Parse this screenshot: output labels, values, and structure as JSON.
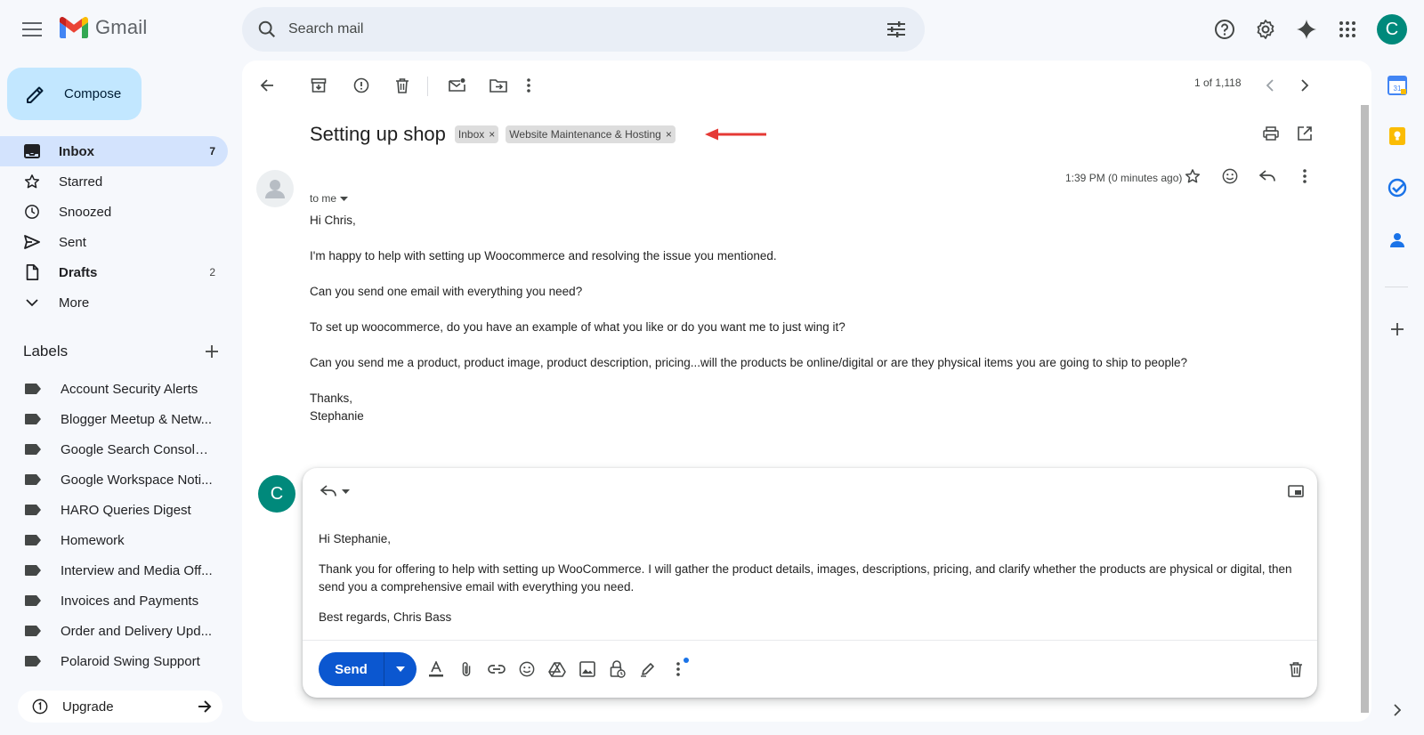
{
  "app": {
    "name": "Gmail"
  },
  "search": {
    "placeholder": "Search mail"
  },
  "sidebar": {
    "compose_label": "Compose",
    "items": [
      {
        "label": "Inbox",
        "count": "7",
        "icon": "inbox-icon"
      },
      {
        "label": "Starred",
        "count": "",
        "icon": "star-icon"
      },
      {
        "label": "Snoozed",
        "count": "",
        "icon": "clock-icon"
      },
      {
        "label": "Sent",
        "count": "",
        "icon": "send-icon"
      },
      {
        "label": "Drafts",
        "count": "2",
        "icon": "draft-icon"
      },
      {
        "label": "More",
        "count": "",
        "icon": "chevron-down-icon"
      }
    ],
    "labels_title": "Labels",
    "labels": [
      "Account Security Alerts",
      "Blogger Meetup & Netw...",
      "Google Search Console ...",
      "Google Workspace Noti...",
      "HARO Queries Digest",
      "Homework",
      "Interview and Media Off...",
      "Invoices and Payments",
      "Order and Delivery Upd...",
      "Polaroid Swing Support"
    ],
    "upgrade_label": "Upgrade"
  },
  "toolbar": {
    "pager": "1 of 1,118"
  },
  "email": {
    "subject": "Setting up shop",
    "chips": [
      "Inbox",
      "Website Maintenance & Hosting"
    ],
    "chip_close": "×",
    "to": "to me",
    "time": "1:39 PM (0 minutes ago)",
    "body": [
      "Hi Chris,",
      "I'm happy to help with setting up Woocommerce and resolving the issue you mentioned.",
      "Can you send one email with everything you need?",
      "To set up woocommerce, do you have an example of what you like or do you want me to just wing it?",
      "Can you send me a product, product image, product description, pricing...will the products be online/digital or are they physical items you are going to ship to people?"
    ],
    "signoff": "Thanks,",
    "signature": "Stephanie"
  },
  "reply": {
    "avatar_letter": "C",
    "body": [
      "Hi Stephanie,",
      "Thank you for offering to help with setting up WooCommerce. I will gather the product details, images, descriptions, pricing, and clarify whether the products are physical or digital, then send you a comprehensive email with everything you need.",
      "Best regards, Chris Bass"
    ],
    "send_label": "Send"
  },
  "user": {
    "avatar_letter": "C"
  },
  "colors": {
    "accent": "#0b57d0",
    "compose_bg": "#c2e7ff",
    "active_nav": "#d3e3fd",
    "avatar": "#00897b",
    "annotation_arrow": "#e53935"
  }
}
